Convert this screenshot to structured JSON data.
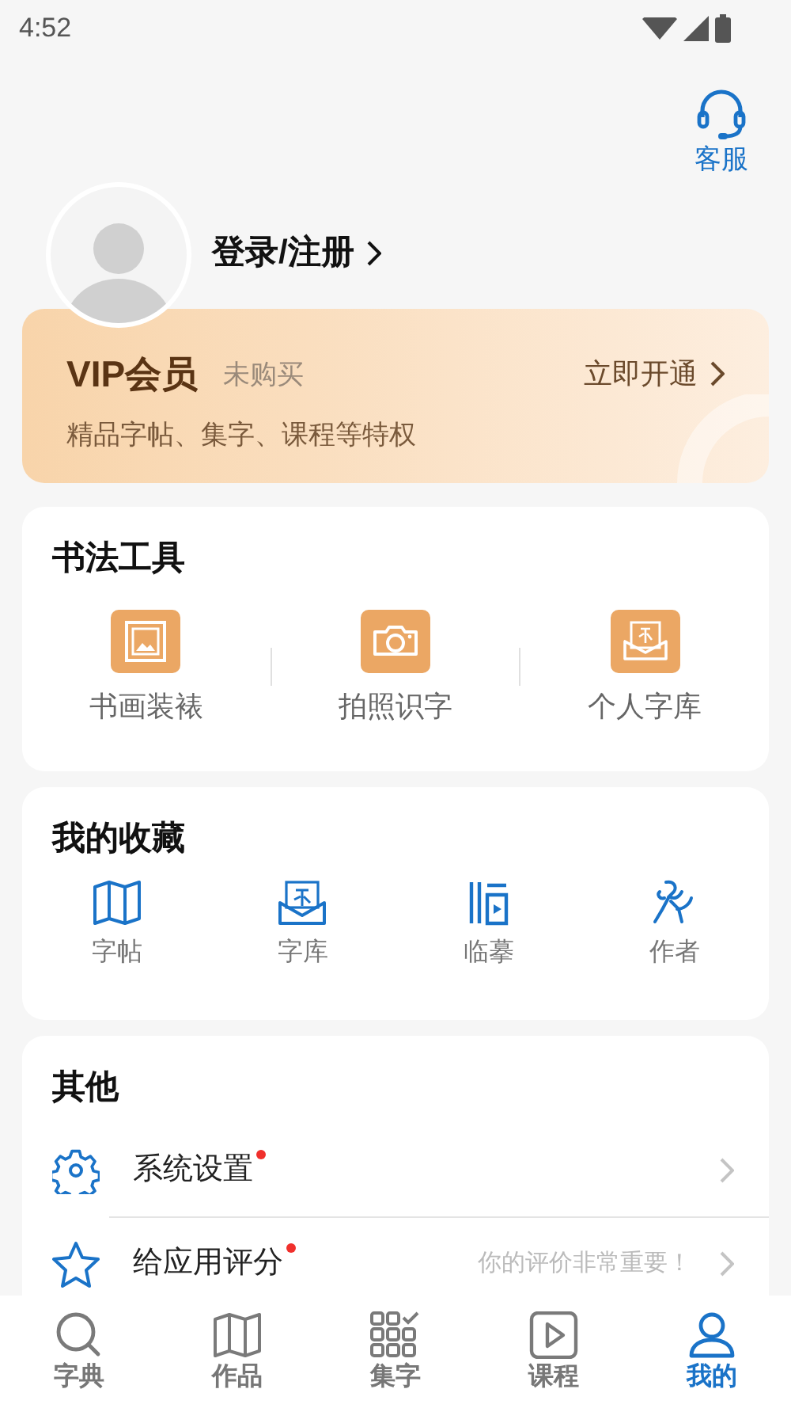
{
  "status_bar": {
    "time": "4:52"
  },
  "header": {
    "service_label": "客服",
    "login_label": "登录/注册"
  },
  "vip": {
    "title": "VIP会员",
    "status": "未购买",
    "action": "立即开通",
    "description": "精品字帖、集字、课程等特权"
  },
  "tools": {
    "title": "书法工具",
    "items": [
      {
        "kind": "frame",
        "label": "书画装裱"
      },
      {
        "kind": "camera",
        "label": "拍照识字"
      },
      {
        "kind": "library",
        "label": "个人字库"
      }
    ]
  },
  "favorites": {
    "title": "我的收藏",
    "items": [
      {
        "kind": "map",
        "label": "字帖"
      },
      {
        "kind": "library",
        "label": "字库"
      },
      {
        "kind": "copy",
        "label": "临摹"
      },
      {
        "kind": "author",
        "label": "作者"
      }
    ]
  },
  "other": {
    "title": "其他",
    "items": [
      {
        "kind": "gear",
        "label": "系统设置",
        "badge": true
      },
      {
        "kind": "star",
        "label": "给应用评分",
        "badge": true,
        "hint": "你的评价非常重要！"
      }
    ]
  },
  "tab_bar": [
    {
      "kind": "search",
      "label": "字典",
      "selected": false
    },
    {
      "kind": "map",
      "label": "作品",
      "selected": false
    },
    {
      "kind": "grid",
      "label": "集字",
      "selected": false
    },
    {
      "kind": "play",
      "label": "课程",
      "selected": false
    },
    {
      "kind": "person",
      "label": "我的",
      "selected": true
    }
  ]
}
